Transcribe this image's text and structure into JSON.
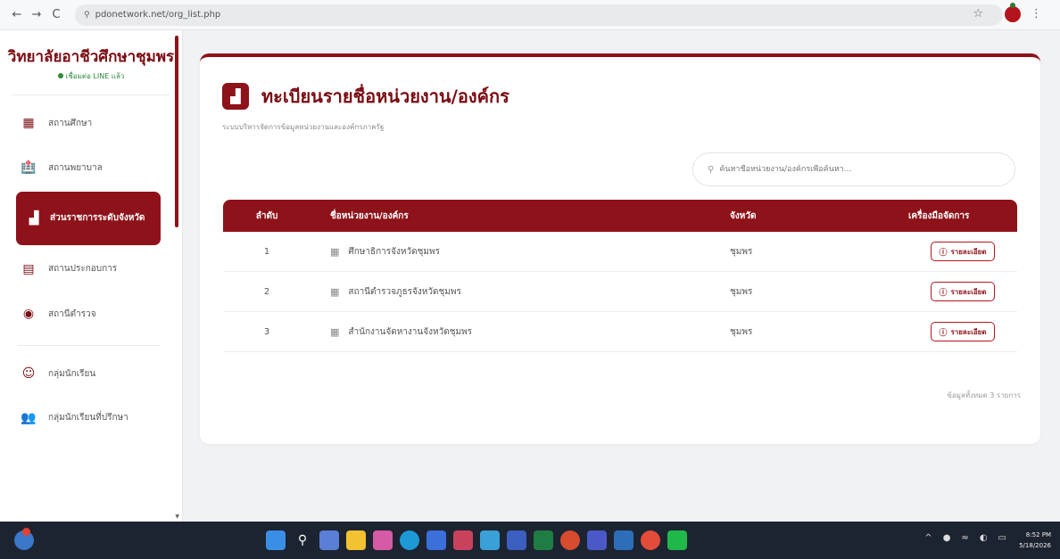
{
  "browser": {
    "url": "pdonetwork.net/org_list.php",
    "back_icon": "←",
    "forward_icon": "→",
    "reload_icon": "C",
    "star_icon": "☆",
    "menu_icon": "⋮"
  },
  "sidebar": {
    "title": "วิทยาลัยอาชีวศึกษาชุมพร",
    "status": "เชื่อมต่อ LINE แล้ว",
    "items": [
      {
        "label": "สถานศึกษา",
        "icon": "building-icon",
        "glyph": "▦"
      },
      {
        "label": "สถานพยาบาล",
        "icon": "hospital-icon",
        "glyph": "🏥"
      },
      {
        "label": "ส่วนราชการระดับจังหวัด",
        "icon": "chart-icon",
        "glyph": "▟",
        "active": true
      },
      {
        "label": "สถานประกอบการ",
        "icon": "factory-icon",
        "glyph": "▤"
      },
      {
        "label": "สถานีตำรวจ",
        "icon": "shield-icon",
        "glyph": "◉"
      }
    ],
    "items2": [
      {
        "label": "กลุ่มนักเรียน",
        "icon": "smile-icon",
        "glyph": "☺"
      },
      {
        "label": "กลุ่มนักเรียนที่ปรึกษา",
        "icon": "users-icon",
        "glyph": "👥"
      }
    ]
  },
  "main": {
    "title": "ทะเบียนรายชื่อหน่วยงาน/องค์กร",
    "subtitle": "ระบบบริหารจัดการข้อมูลหน่วยงานและองค์กรภาครัฐ",
    "search_placeholder": "ค้นหาชื่อหน่วยงาน/องค์กรเพื่อค้นหา...",
    "table": {
      "headers": [
        "ลำดับ",
        "ชื่อหน่วยงาน/องค์กร",
        "จังหวัด",
        "เครื่องมือจัดการ"
      ],
      "rows": [
        {
          "no": "1",
          "name": "ศึกษาธิการจังหวัดชุมพร",
          "province": "ชุมพร",
          "action": "รายละเอียด"
        },
        {
          "no": "2",
          "name": "สถานีตำรวจภูธรจังหวัดชุมพร",
          "province": "ชุมพร",
          "action": "รายละเอียด"
        },
        {
          "no": "3",
          "name": "สำนักงานจัดหางานจังหวัดชุมพร",
          "province": "ชุมพร",
          "action": "รายละเอียด"
        }
      ]
    },
    "total_note": "ข้อมูลทั้งหมด 3 รายการ"
  },
  "taskbar": {
    "time": "8:52 PM",
    "date": "5/18/2026",
    "apps": [
      "windows-icon",
      "search-icon",
      "taskview-icon",
      "explorer-icon",
      "copilot-icon",
      "edge-icon",
      "store-icon",
      "app-icon",
      "app-icon",
      "app-icon",
      "excel-icon",
      "app-icon",
      "teams-icon",
      "photos-icon",
      "chrome-icon",
      "line-icon"
    ]
  }
}
